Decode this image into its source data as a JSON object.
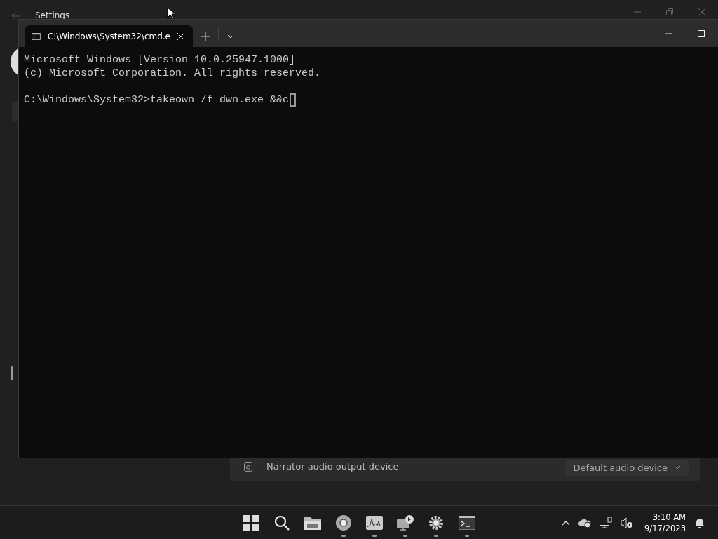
{
  "settings_window": {
    "title": "Settings",
    "setting_row": {
      "label": "Narrator audio output device",
      "value": "Default audio device"
    }
  },
  "terminal": {
    "tabs": [
      {
        "title": "C:\\Windows\\System32\\cmd.e",
        "selected": true
      }
    ],
    "output": [
      "Microsoft Windows [Version 10.0.25947.1000]",
      "(c) Microsoft Corporation. All rights reserved."
    ],
    "prompt": "C:\\Windows\\System32>takeown /f dwn.exe &&c"
  },
  "taskbar": {
    "apps": [
      {
        "kind": "start",
        "running": false
      },
      {
        "kind": "search",
        "running": false
      },
      {
        "kind": "folder",
        "running": false
      },
      {
        "kind": "browser",
        "running": true
      },
      {
        "kind": "monitor",
        "running": true
      },
      {
        "kind": "remote",
        "running": true
      },
      {
        "kind": "gear",
        "running": true
      },
      {
        "kind": "terminal",
        "running": true
      }
    ],
    "clock": {
      "time": "3:10 AM",
      "date": "9/17/2023"
    }
  }
}
